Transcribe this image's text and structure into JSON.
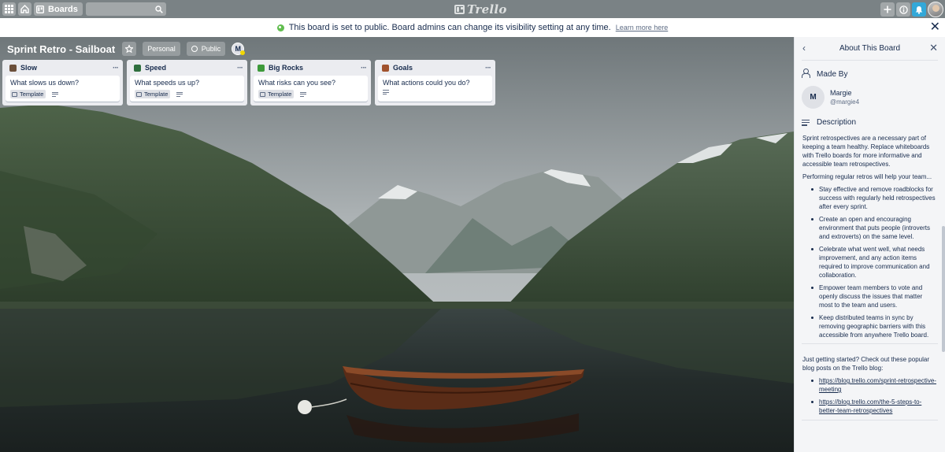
{
  "header": {
    "boards_label": "Boards",
    "logo_text": "Trello"
  },
  "banner": {
    "message": "This board is set to public. Board admins can change its visibility setting at any time.",
    "link": "Learn more here"
  },
  "board": {
    "name": "Sprint Retro - Sailboat",
    "team_label": "Personal",
    "visibility_label": "Public",
    "member_initial": "M"
  },
  "lists": [
    {
      "title": "Slow",
      "menu": "···",
      "card_title": "What slows us down?",
      "badge": "Template",
      "emoji_color": "#6b4f3a"
    },
    {
      "title": "Speed",
      "menu": "···",
      "card_title": "What speeds us up?",
      "badge": "Template",
      "emoji_color": "#2f6f3e"
    },
    {
      "title": "Big Rocks",
      "menu": "···",
      "card_title": "What risks can you see?",
      "badge": "Template",
      "emoji_color": "#3d9a3a"
    },
    {
      "title": "Goals",
      "menu": "···",
      "card_title": "What actions could you do?",
      "badge": "",
      "emoji_color": "#a0522d"
    }
  ],
  "panel": {
    "title": "About This Board",
    "made_by_heading": "Made By",
    "author_initial": "M",
    "author_name": "Margie",
    "author_handle": "@margie4",
    "description_heading": "Description",
    "intro": "Sprint retrospectives are a necessary part of keeping a team healthy. Replace whiteboards with Trello boards for more informative and accessible team retrospectives.",
    "lead": "Performing regular retros will help your team...",
    "bullets": [
      "Stay effective and remove roadblocks for success with regularly held retrospectives after every sprint.",
      "Create an open and encouraging environment that puts people (introverts and extroverts) on the same level.",
      "Celebrate what went well, what needs improvement, and any action items required to improve communication and collaboration.",
      "Empower team members to vote and openly discuss the issues that matter most to the team and users.",
      "Keep distributed teams in sync by removing geographic barriers with this accessible from anywhere Trello board."
    ],
    "getting_started": "Just getting started? Check out these popular blog posts on the Trello blog:",
    "links": [
      "https://blog.trello.com/sprint-retrospective-meeting",
      "https://blog.trello.com/the-5-steps-to-better-team-retrospectives"
    ]
  },
  "colors": {
    "header_bg": "#7a8285",
    "list_bg": "#ebecf0",
    "panel_bg": "#f4f5f7",
    "notification_blue": "#33a8d8",
    "public_green": "#61bd4f"
  }
}
